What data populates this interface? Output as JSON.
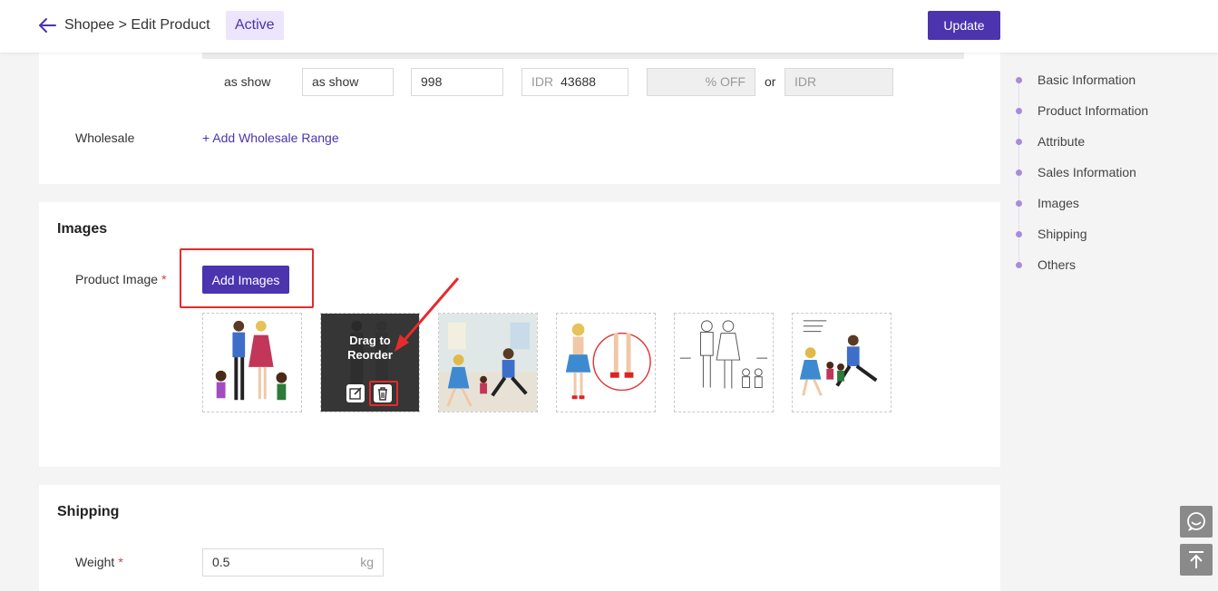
{
  "header": {
    "breadcrumb": "Shopee > Edit Product",
    "status": "Active",
    "update_label": "Update"
  },
  "sales": {
    "variation_name": "as show",
    "variation_value": "as show",
    "stock": "998",
    "price_prefix": "IDR",
    "price": "43688",
    "discount_suffix": "% OFF",
    "or_text": "or",
    "discount_price_prefix": "IDR",
    "wholesale_label": "Wholesale",
    "add_wholesale_label": "+ Add Wholesale Range"
  },
  "images": {
    "section_title": "Images",
    "product_image_label": "Product Image",
    "required_mark": "*",
    "add_images_label": "Add Images",
    "drag_line1": "Drag to",
    "drag_line2": "Reorder"
  },
  "shipping": {
    "section_title": "Shipping",
    "weight_label": "Weight",
    "required_mark": "*",
    "weight_value": "0.5",
    "weight_unit": "kg"
  },
  "sidenav": {
    "items": [
      {
        "label": "Basic Information"
      },
      {
        "label": "Product Information"
      },
      {
        "label": "Attribute"
      },
      {
        "label": "Sales Information"
      },
      {
        "label": "Images"
      },
      {
        "label": "Shipping"
      },
      {
        "label": "Others"
      }
    ]
  },
  "colors": {
    "primary": "#4b34ad",
    "annotation_red": "#e52b2b",
    "status_bg": "#ece5fb"
  },
  "icons": [
    "back-arrow-icon",
    "edit-icon",
    "trash-icon",
    "chat-icon",
    "back-to-top-icon"
  ]
}
